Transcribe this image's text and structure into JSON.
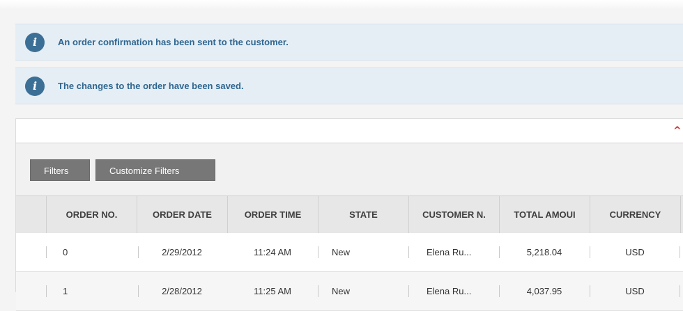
{
  "notifications": [
    {
      "icon": "info-icon",
      "message": "An order confirmation has been sent to the customer."
    },
    {
      "icon": "info-icon",
      "message": "The changes to the order have been saved."
    }
  ],
  "filters": {
    "filters_label": "Filters",
    "customize_label": "Customize Filters"
  },
  "colors": {
    "notice_bg": "#e5eef5",
    "notice_text": "#2f668f",
    "info_icon": "#3b6f96",
    "button_bg": "#777777",
    "collapse_icon": "#d0302a"
  },
  "table": {
    "columns": [
      "ORDER NO.",
      "ORDER DATE",
      "ORDER TIME",
      "STATE",
      "CUSTOMER N.",
      "TOTAL AMOUI",
      "CURRENCY"
    ],
    "rows": [
      [
        "0",
        "2/29/2012",
        "11:24 AM",
        "New",
        "Elena Ru...",
        "5,218.04",
        "USD"
      ],
      [
        "1",
        "2/28/2012",
        "11:25 AM",
        "New",
        "Elena Ru...",
        "4,037.95",
        "USD"
      ]
    ]
  }
}
